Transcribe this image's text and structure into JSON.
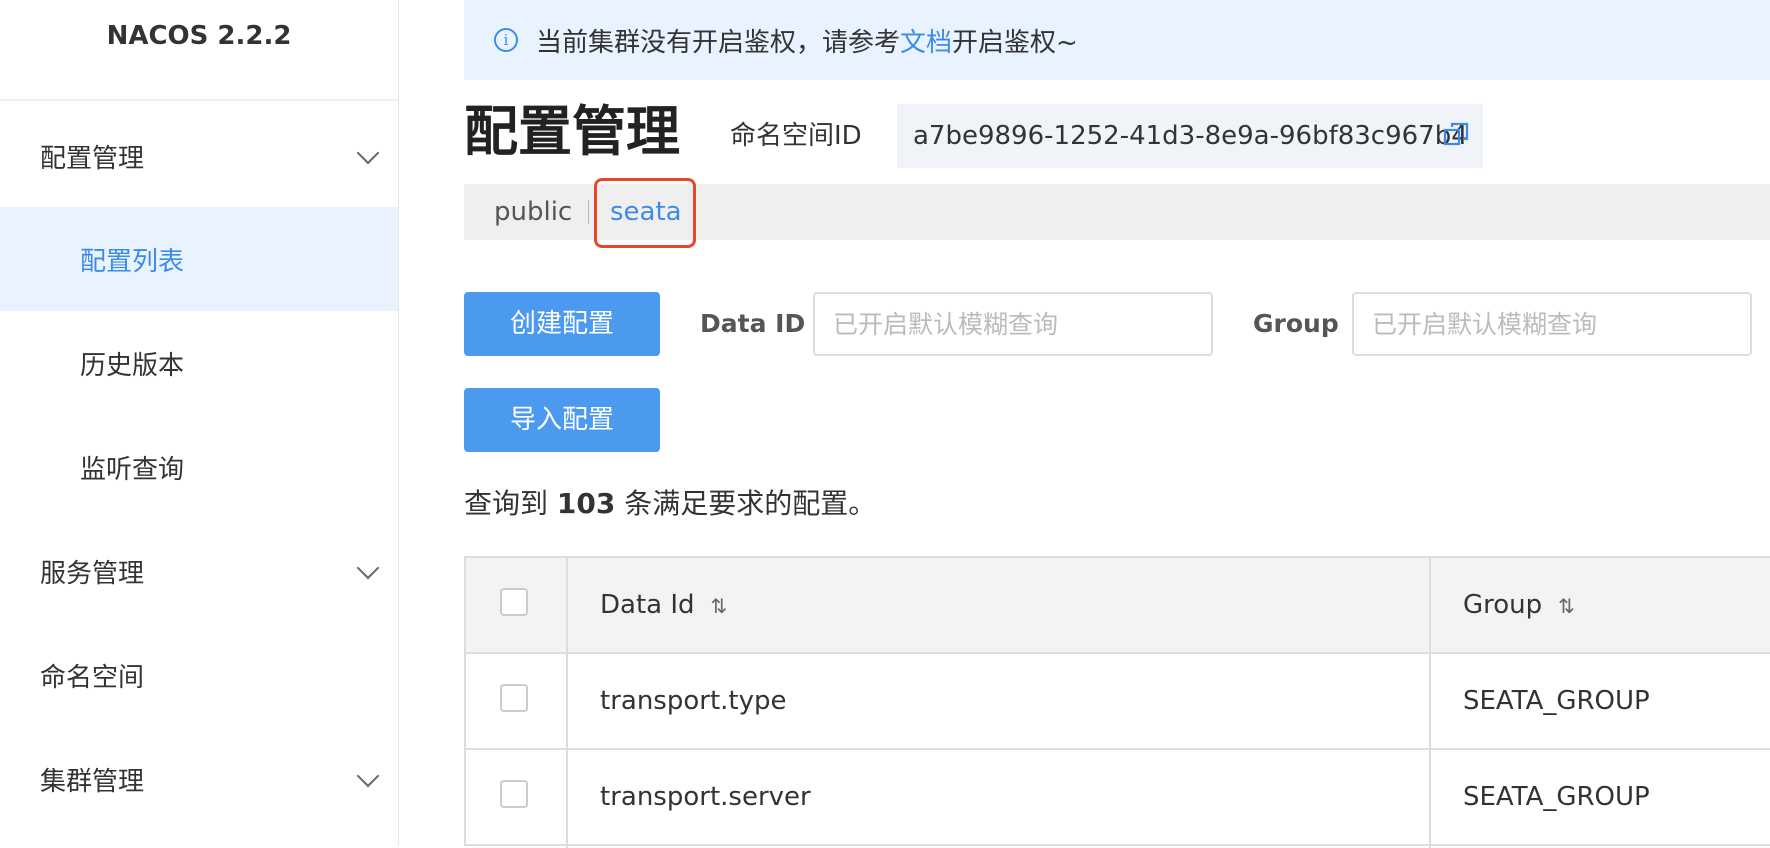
{
  "app": {
    "brand": "NACOS 2.2.2"
  },
  "sidebar": {
    "items": [
      {
        "label": "配置管理",
        "type": "group",
        "expandable": true
      },
      {
        "label": "配置列表",
        "type": "sub",
        "active": true
      },
      {
        "label": "历史版本",
        "type": "sub"
      },
      {
        "label": "监听查询",
        "type": "sub"
      },
      {
        "label": "服务管理",
        "type": "group",
        "expandable": true
      },
      {
        "label": "命名空间",
        "type": "group"
      },
      {
        "label": "集群管理",
        "type": "group",
        "expandable": true
      }
    ]
  },
  "notice": {
    "prefix": "当前集群没有开启鉴权，请参考",
    "link": "文档",
    "suffix": "开启鉴权~"
  },
  "header": {
    "title": "配置管理",
    "namespace_label": "命名空间ID",
    "namespace_id": "a7be9896-1252-41d3-8e9a-96bf83c967b4"
  },
  "namespace_tabs": [
    {
      "label": "public",
      "active": false
    },
    {
      "label": "seata",
      "active": true
    }
  ],
  "toolbar": {
    "create_button": "创建配置",
    "import_button": "导入配置",
    "data_id_label": "Data ID",
    "data_id_placeholder": "已开启默认模糊查询",
    "group_label": "Group",
    "group_placeholder": "已开启默认模糊查询"
  },
  "result": {
    "prefix": "查询到",
    "count": "103",
    "suffix": "条满足要求的配置。"
  },
  "table": {
    "columns": [
      "Data Id",
      "Group"
    ],
    "rows": [
      {
        "data_id": "transport.type",
        "group": "SEATA_GROUP"
      },
      {
        "data_id": "transport.server",
        "group": "SEATA_GROUP"
      }
    ]
  },
  "colors": {
    "accent": "#3c8ce7",
    "button": "#4c9af0",
    "highlight": "#e8472e"
  }
}
